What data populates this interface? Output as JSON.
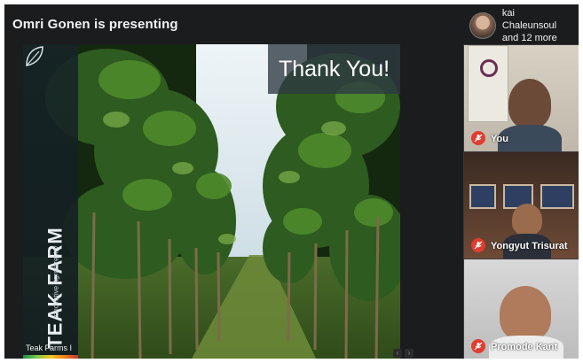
{
  "header": {
    "presenter_text": "Omri Gonen is presenting",
    "participants_line1": "kai Chaleunsoul",
    "participants_line2": "and 12 more"
  },
  "slide": {
    "thank_you": "Thank You!",
    "brand_title": "TEAK FARM",
    "brand_subtitle": "Innovative Agroforestry",
    "footer_text": "Teak Farms I"
  },
  "tiles": [
    {
      "name": "You",
      "muted": true
    },
    {
      "name": "Yongyut Trisurat",
      "muted": true
    },
    {
      "name": "Promode Kant",
      "muted": true
    }
  ],
  "colors": {
    "mic_muted": "#e03c2f",
    "background": "#1b1c1e"
  },
  "icons": {
    "mic_muted": "mic-off-icon",
    "brand_leaf": "leaf-icon",
    "participants_avatar": "avatar"
  }
}
